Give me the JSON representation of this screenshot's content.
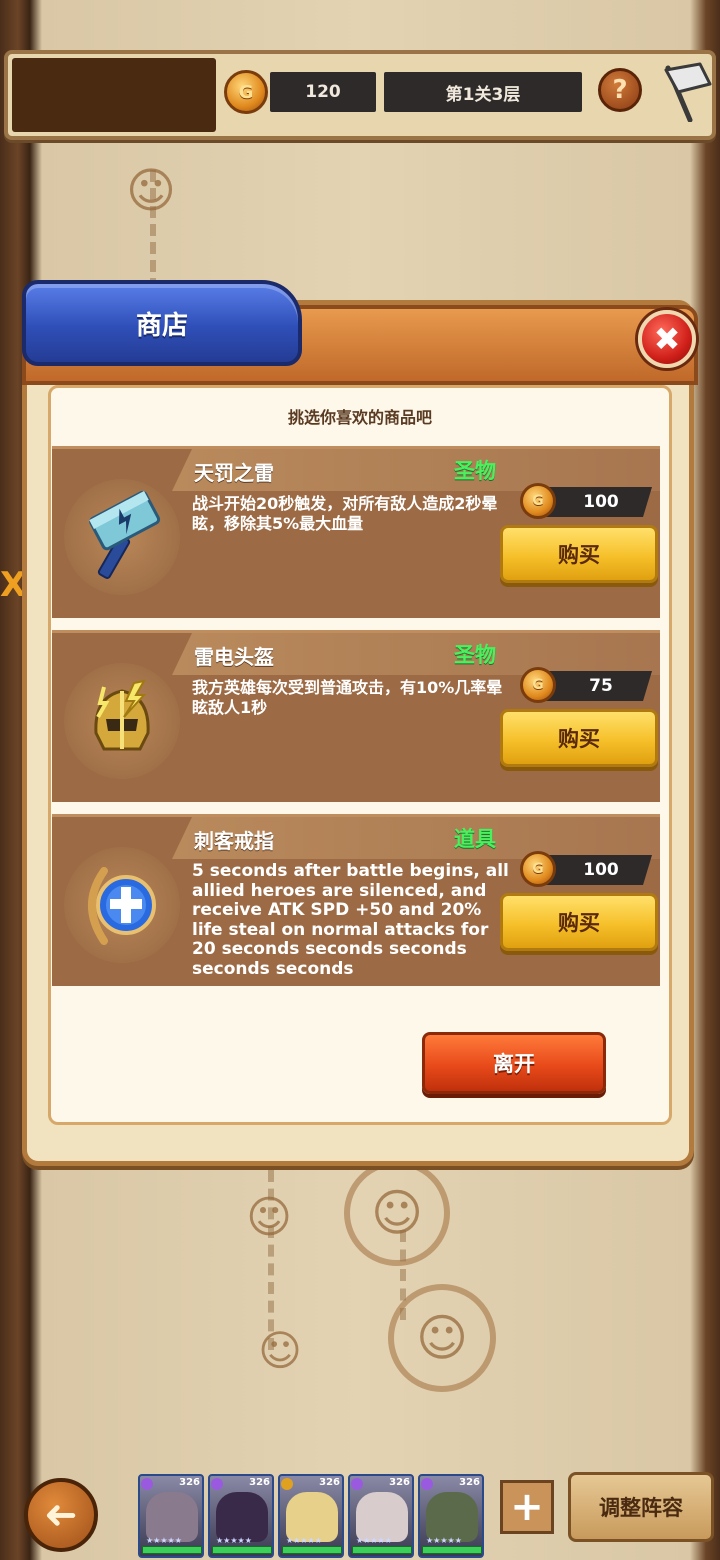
{
  "top_bar": {
    "gold_amount": "120",
    "stage_label": "第1关3层",
    "help_glyph": "?",
    "coin_glyph": "G"
  },
  "shop": {
    "tab_title": "商店",
    "close_glyph": "✖",
    "subtitle": "挑选你喜欢的商品吧",
    "coin_glyph": "G",
    "items": [
      {
        "name": "天罚之雷",
        "type": "圣物",
        "description": "战斗开始20秒触发，对所有敌人造成2秒晕眩，移除其5%最大血量",
        "price": "100",
        "buy_label": "购买",
        "icon": "hammer-icon"
      },
      {
        "name": "雷电头盔",
        "type": "圣物",
        "description": "我方英雄每次受到普通攻击，有10%几率晕眩敌人1秒",
        "price": "75",
        "buy_label": "购买",
        "icon": "helmet-icon"
      },
      {
        "name": "刺客戒指",
        "type": "道具",
        "description": "5 seconds after battle begins, all allied heroes are silenced, and receive ATK SPD +50 and 20% life steal on normal attacks for 20 seconds seconds seconds seconds seconds",
        "price": "100",
        "buy_label": "购买",
        "icon": "ring-icon"
      }
    ],
    "leave_label": "离开"
  },
  "bottom_bar": {
    "back_glyph": "➜",
    "heroes": [
      {
        "level": "326",
        "gem_color": "#9a5ae0",
        "face_color": "#8a7a8e"
      },
      {
        "level": "326",
        "gem_color": "#9a5ae0",
        "face_color": "#3a2a4a"
      },
      {
        "level": "326",
        "gem_color": "#e0a020",
        "face_color": "#e6d08a"
      },
      {
        "level": "326",
        "gem_color": "#9a5ae0",
        "face_color": "#d8cccc"
      },
      {
        "level": "326",
        "gem_color": "#9a5ae0",
        "face_color": "#5a6a4a"
      }
    ],
    "stars": "★★★★★",
    "add_glyph": "+",
    "lineup_label": "调整阵容"
  },
  "map": {
    "edge_text": "XD",
    "enemy_glyph": "☺"
  },
  "colors": {
    "tab_blue": "#2f4fb8",
    "buy_yellow": "#f6c02a",
    "leave_orange": "#e84a1a",
    "type_green": "#4bf05e",
    "card_brown": "#9c6a44"
  }
}
